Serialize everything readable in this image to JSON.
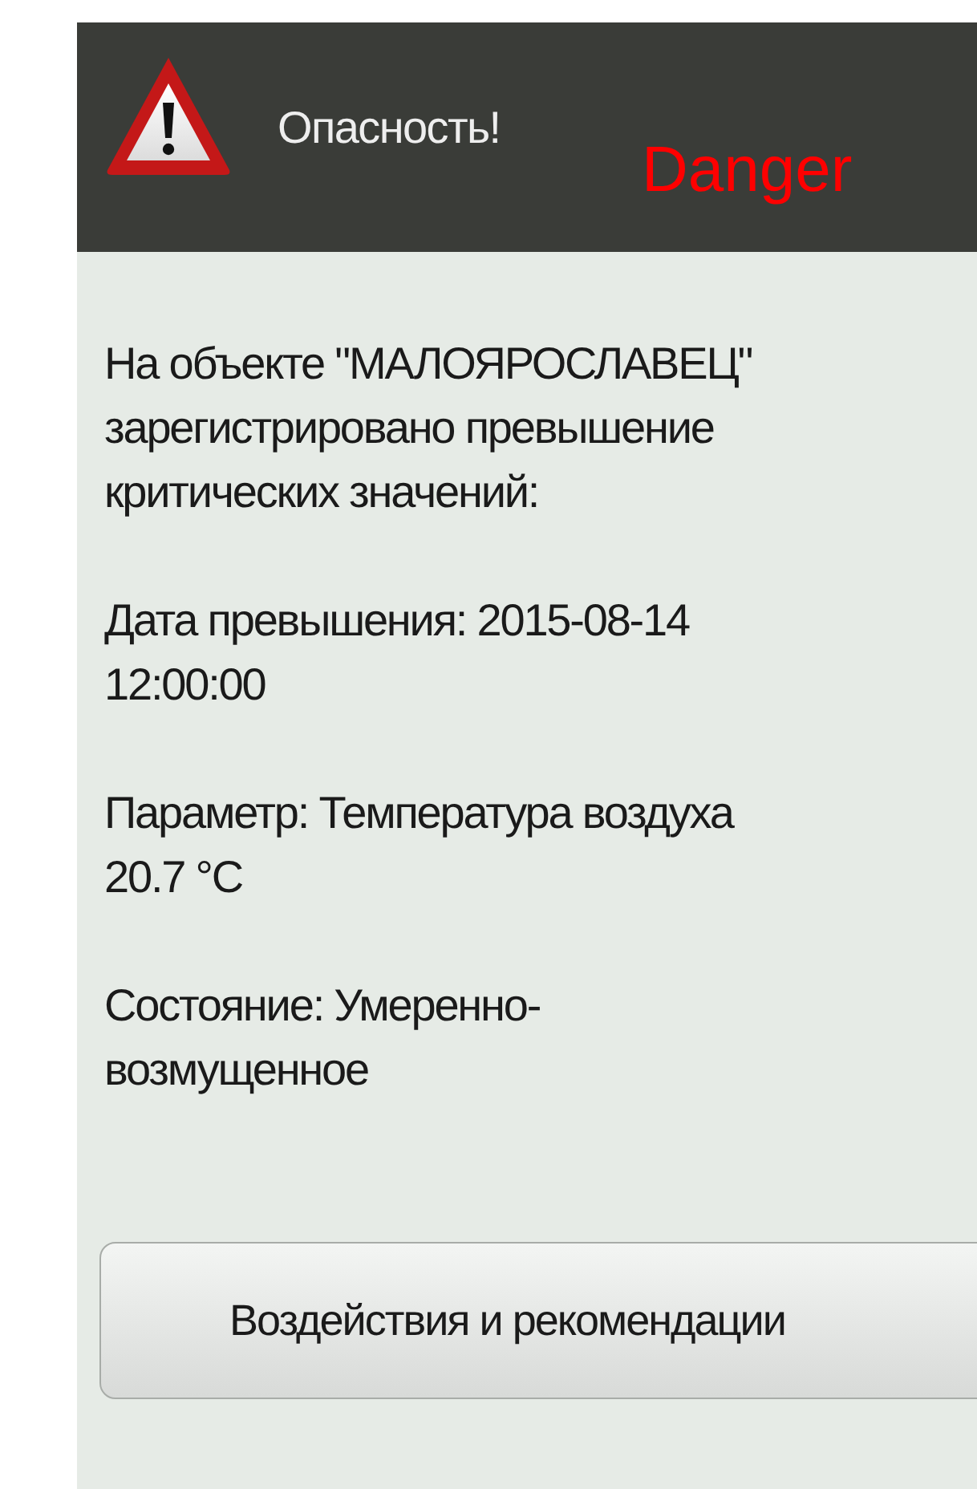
{
  "dialog": {
    "title": "Опасность!",
    "annotation": "Danger",
    "paragraphs": [
      {
        "lines": [
          "На объекте \"МАЛОЯРОСЛАВЕЦ\"",
          "зарегистрировано превышение",
          "критических значений:"
        ]
      },
      {
        "lines": [
          "Дата превышения: 2015-08-14",
          "12:00:00"
        ]
      },
      {
        "lines": [
          "Параметр: Температура воздуха",
          "20.7 °C"
        ]
      },
      {
        "lines": [
          "Состояние: Умеренно-",
          "возмущенное"
        ]
      }
    ],
    "button": "Воздействия и рекомендации"
  }
}
